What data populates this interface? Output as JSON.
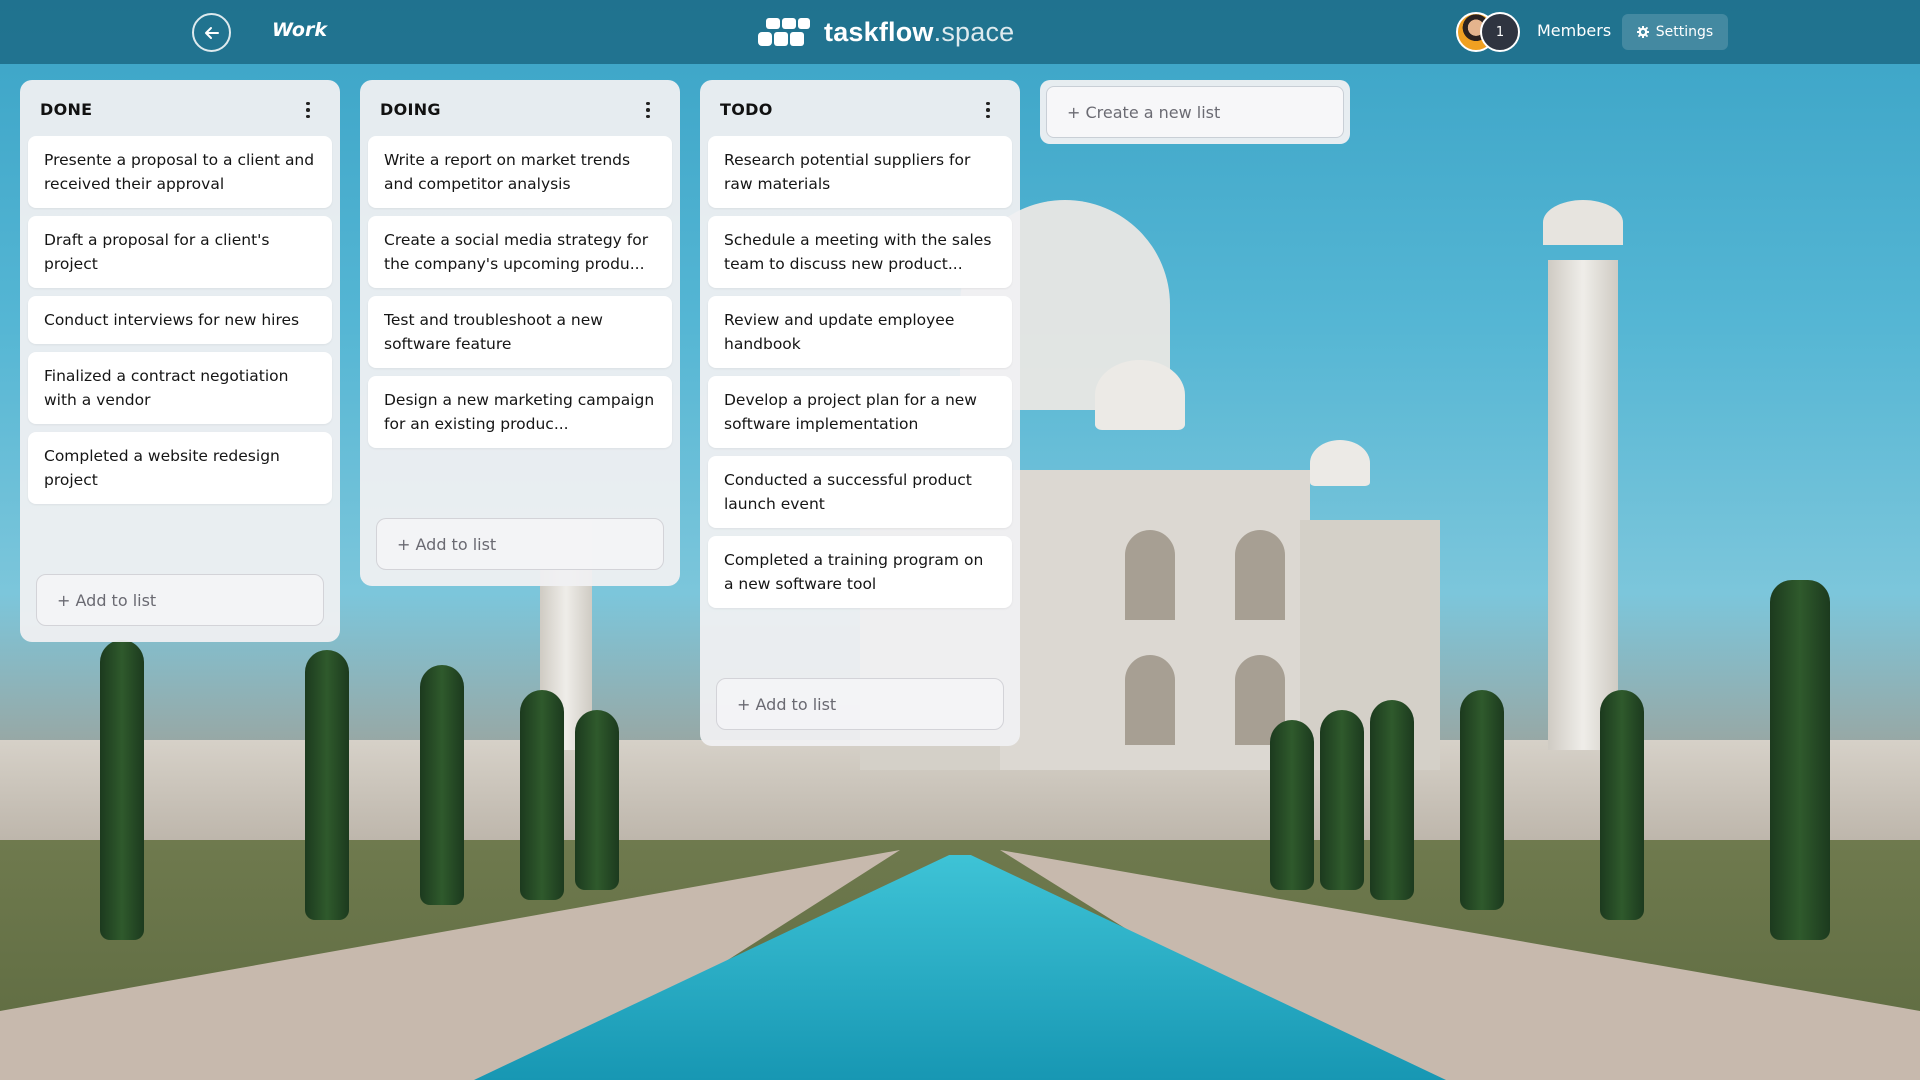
{
  "header": {
    "board_title": "Work",
    "brand_name": "taskflow",
    "brand_tld": ".space",
    "member_count": "1",
    "members_label": "Members",
    "settings_label": "Settings"
  },
  "lists": [
    {
      "title": "DONE",
      "cards": [
        "Presente a proposal to a client and received their approval",
        "Draft a proposal for a client's project",
        "Conduct interviews for new hires",
        "Finalized a contract negotiation with a vendor",
        "Completed a website redesign project"
      ],
      "add_label": "+ Add to list"
    },
    {
      "title": "DOING",
      "cards": [
        "Write a report on market trends and competitor analysis",
        "Create a social media strategy for the company's upcoming produ...",
        "Test and troubleshoot a new software feature",
        "Design a new marketing campaign for an existing produc..."
      ],
      "add_label": "+ Add to list"
    },
    {
      "title": "TODO",
      "cards": [
        "Research potential suppliers for raw materials",
        "Schedule a meeting with the sales team to discuss new product...",
        "Review and update employee handbook",
        "Develop a project plan for a new software implementation",
        "Conducted a successful product launch event",
        "Completed a training program on a new software tool"
      ],
      "add_label": "+ Add to list"
    }
  ],
  "create_list_label": "+ Create a new list"
}
